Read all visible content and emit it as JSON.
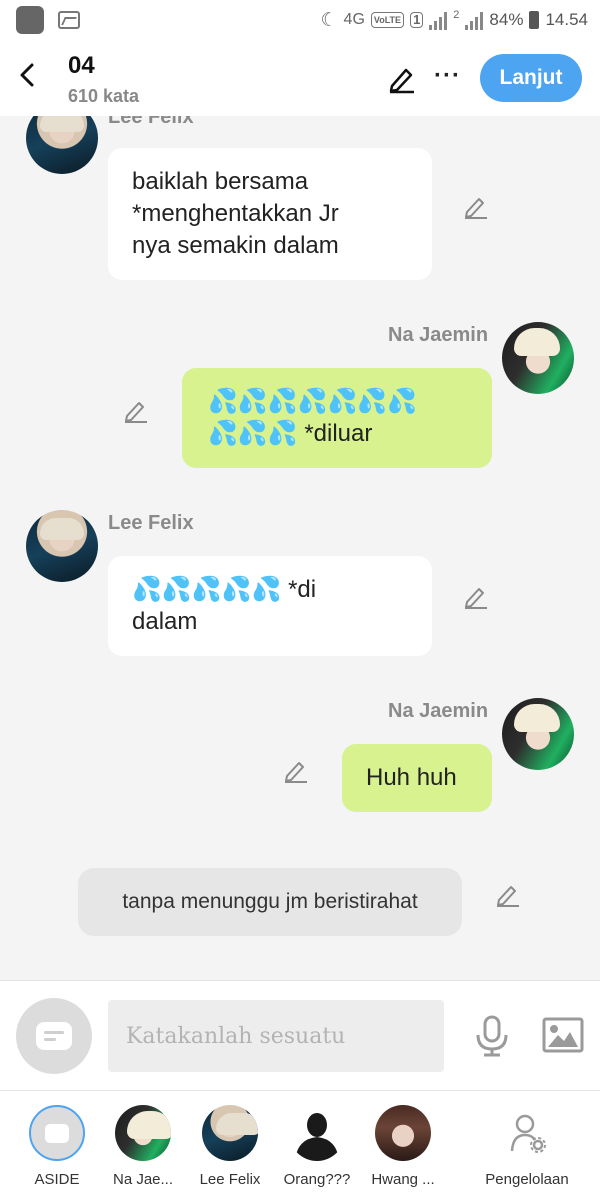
{
  "status_bar": {
    "network": "4G",
    "volte": "VoLTE",
    "sim1": "1",
    "sim2": "2",
    "battery": "84%",
    "time": "14.54"
  },
  "header": {
    "title": "04",
    "subtitle": "610 kata",
    "next_label": "Lanjut"
  },
  "messages": [
    {
      "sender": "Lee Felix",
      "side": "left",
      "lines": [
        "baiklah bersama",
        "*menghentakkan Jr",
        "nya semakin dalam"
      ]
    },
    {
      "sender": "Na Jaemin",
      "side": "right",
      "lines": [
        "💦💦💦💦💦💦💦",
        "💦💦💦 *diluar"
      ]
    },
    {
      "sender": "Lee Felix",
      "side": "left",
      "lines": [
        "💦💦💦💦💦 *di",
        "dalam"
      ]
    },
    {
      "sender": "Na Jaemin",
      "side": "right",
      "lines": [
        "Huh huh"
      ]
    },
    {
      "sender": "",
      "side": "narration",
      "lines": [
        "tanpa menunggu jm beristirahat"
      ]
    }
  ],
  "input": {
    "placeholder": "Katakanlah sesuatu"
  },
  "characters": [
    {
      "label": "ASIDE"
    },
    {
      "label": "Na Jae..."
    },
    {
      "label": "Lee Felix"
    },
    {
      "label": "Orang???"
    },
    {
      "label": "Hwang ..."
    },
    {
      "label": "Pengelolaan"
    }
  ],
  "colors": {
    "accent": "#4da4f0",
    "outgoing_bubble": "#d7f28f",
    "incoming_bubble": "#ffffff",
    "narration_bubble": "#e6e6e6",
    "background": "#f4f4f4"
  },
  "icons": [
    "back-arrow-icon",
    "pencil-icon",
    "more-icon",
    "microphone-icon",
    "image-icon",
    "manage-user-icon"
  ]
}
